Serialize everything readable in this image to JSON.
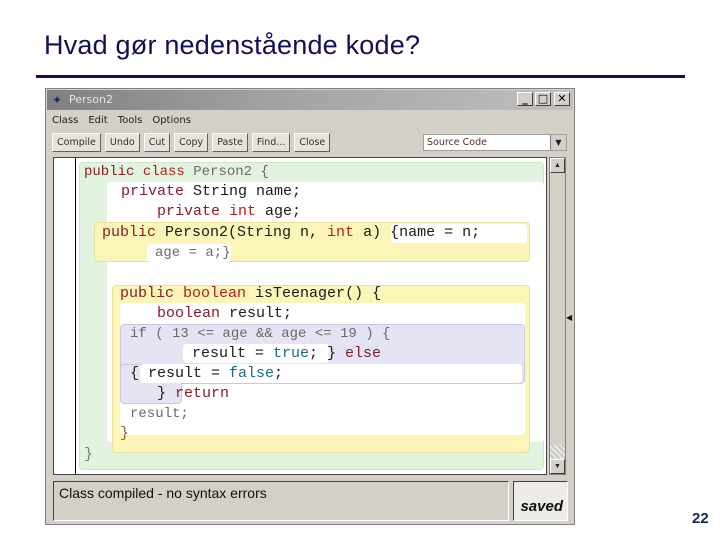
{
  "slide": {
    "title": "Hvad gør nedenstående kode?",
    "page_number": "22"
  },
  "window": {
    "title": "Person2",
    "app_icon": "bluej-bird-icon",
    "controls": {
      "minimize": "_",
      "maximize": "□",
      "close": "✕"
    }
  },
  "menu": {
    "items": [
      "Class",
      "Edit",
      "Tools",
      "Options"
    ]
  },
  "toolbar": {
    "buttons": [
      "Compile",
      "Undo",
      "Cut",
      "Copy",
      "Paste",
      "Find...",
      "Close"
    ]
  },
  "view_select": {
    "selected": "Source Code",
    "arrow": "▼"
  },
  "code": {
    "l1": {
      "kw1": "public",
      "kw2": "class",
      "rest": " Person2 {"
    },
    "l2": {
      "kw1": "private",
      "rest": " String name;"
    },
    "l3": {
      "kw1": "private",
      "kw2": "int",
      "rest": " age;"
    },
    "l4": {
      "kw1": "public",
      "mid": " Person2(String n, ",
      "kw2": "int",
      "rest": " a) {name = n;"
    },
    "l5": {
      "text": "age = a;}"
    },
    "l6": {
      "kw1": "public",
      "kw2": "boolean",
      "rest": " isTeenager() {"
    },
    "l7": {
      "kw1": "boolean",
      "rest": " result;"
    },
    "l8": {
      "text": "if ( 13 <= age && age <= 19 ) {"
    },
    "l9": {
      "pre": "result = ",
      "lit": "true",
      "post": "; } ",
      "kw": "else"
    },
    "l10": {
      "pre": "{ result = ",
      "lit": "false",
      "post": ";"
    },
    "l11": {
      "pre": "} ",
      "kw": "return"
    },
    "l12": {
      "text": "result;"
    },
    "l13": {
      "text": "}"
    },
    "l14": {
      "text": "}"
    }
  },
  "scrollbar": {
    "up": "▲",
    "down": "▼",
    "split_marker": "◀"
  },
  "status": {
    "message": "Class compiled - no syntax errors",
    "saved": "saved"
  }
}
